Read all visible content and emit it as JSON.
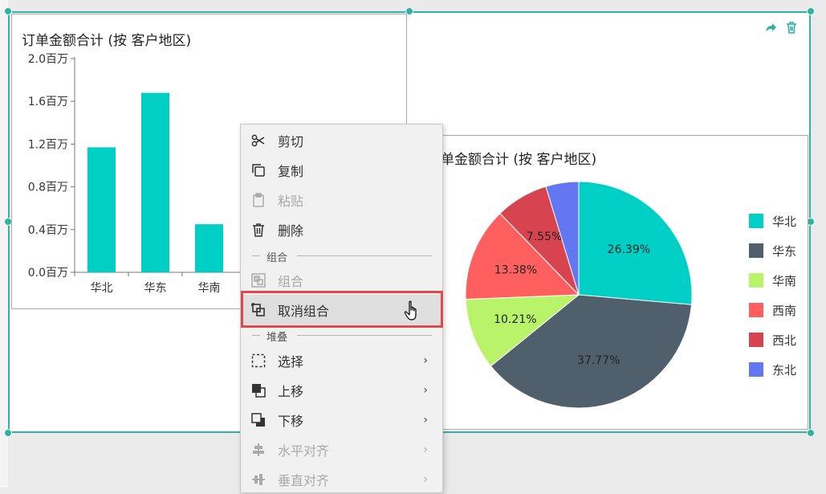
{
  "colors": {
    "accent": "#2bb3a3",
    "menu_highlight_border": "#e04a4a"
  },
  "icons": {
    "share": "share-icon",
    "delete": "trash-icon"
  },
  "bar_chart": {
    "title": "订单金额合计 (按 客户地区)"
  },
  "pie_chart": {
    "title": "单金额合计 (按 客户地区)"
  },
  "chart_data": [
    {
      "type": "bar",
      "title": "订单金额合计 (按 客户地区)",
      "categories": [
        "华北",
        "华东",
        "华南"
      ],
      "values": [
        1.17,
        1.68,
        0.45
      ],
      "value_unit": "百万",
      "yticks": [
        "0.0百万",
        "0.4百万",
        "0.8百万",
        "1.2百万",
        "1.6百万",
        "2.0百万"
      ],
      "ylim": [
        0,
        2.0
      ],
      "color": "#00cfc6"
    },
    {
      "type": "pie",
      "title": "单金额合计 (按 客户地区)",
      "categories": [
        "华北",
        "华东",
        "华南",
        "西南",
        "西北",
        "东北"
      ],
      "labels": [
        "26.39%",
        "37.77%",
        "10.21%",
        "13.38%",
        "7.55%",
        ""
      ],
      "values": [
        26.39,
        37.77,
        10.21,
        13.38,
        7.55,
        4.7
      ],
      "colors": [
        "#00cfc6",
        "#4f5f6c",
        "#b8f36a",
        "#ff5f5f",
        "#d7434f",
        "#6477f2"
      ],
      "legend_position": "right"
    }
  ],
  "context_menu": {
    "items": [
      {
        "label": "剪切",
        "icon": "scissors-icon",
        "disabled": false
      },
      {
        "label": "复制",
        "icon": "copy-icon",
        "disabled": false
      },
      {
        "label": "粘贴",
        "icon": "clipboard-icon",
        "disabled": true
      },
      {
        "label": "删除",
        "icon": "trash-icon",
        "disabled": false
      },
      {
        "label": "组合",
        "icon": "group-icon",
        "disabled": true
      },
      {
        "label": "取消组合",
        "icon": "ungroup-icon",
        "disabled": false,
        "highlighted": true
      },
      {
        "label": "选择",
        "icon": "select-icon",
        "disabled": false,
        "submenu": true
      },
      {
        "label": "上移",
        "icon": "bring-forward-icon",
        "disabled": false,
        "submenu": true
      },
      {
        "label": "下移",
        "icon": "send-backward-icon",
        "disabled": false,
        "submenu": true
      },
      {
        "label": "水平对齐",
        "icon": "align-horizontal-icon",
        "disabled": true,
        "submenu": true
      },
      {
        "label": "垂直对齐",
        "icon": "align-vertical-icon",
        "disabled": true,
        "submenu": true
      }
    ],
    "sections": {
      "group": "组合",
      "stack": "堆叠"
    },
    "submenu_arrow": "›"
  }
}
